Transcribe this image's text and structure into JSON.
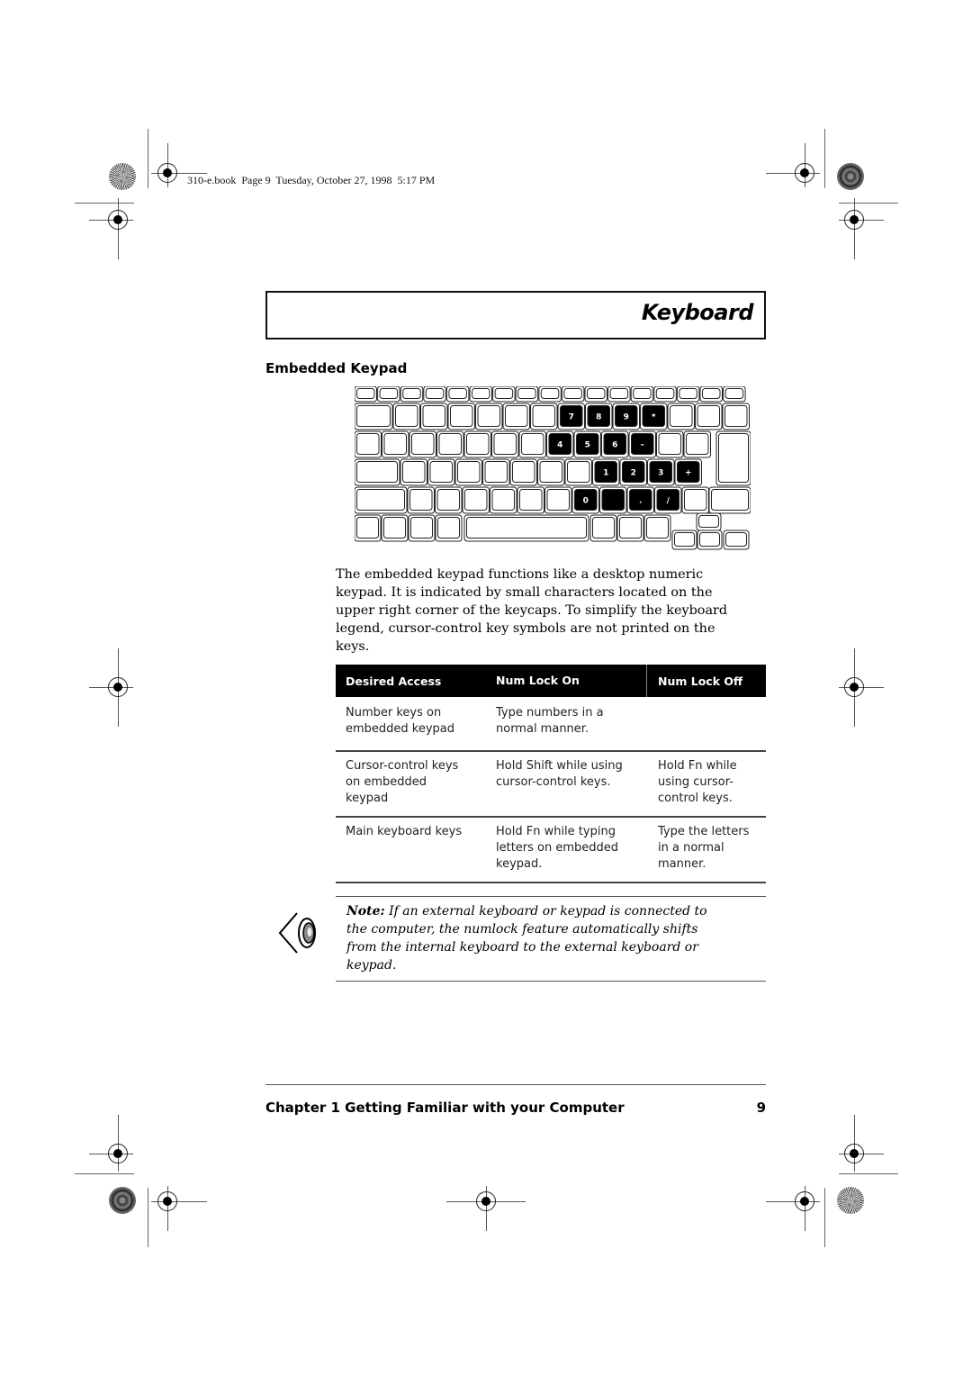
{
  "print_header": {
    "text": "310-e.book  Page 9  Tuesday, October 27, 1998  5:17 PM"
  },
  "page": {
    "section_title": "Keyboard",
    "heading": "Embedded Keypad",
    "figure": {
      "name": "keyboard-layout-illustration",
      "highlighted_keys": [
        "7",
        "8",
        "9",
        "*",
        "4",
        "5",
        "6",
        "–",
        "1",
        "2",
        "3",
        "+",
        "0",
        "",
        ".",
        "/"
      ]
    },
    "body_lines": [
      "The embedded keypad functions like a desktop numeric",
      "keypad.  It is indicated by small characters located on the",
      "upper right corner of the keycaps.  To simplify the keyboard",
      "legend, cursor-control key symbols are not printed on the",
      "keys."
    ],
    "table": {
      "headers": [
        "Desired Access",
        "Num Lock On",
        "Num Lock Off"
      ],
      "rows": [
        {
          "access": [
            "Number keys on",
            "embedded keypad"
          ],
          "on": [
            "Type numbers in a",
            "normal manner."
          ],
          "off": []
        },
        {
          "access": [
            "Cursor-control keys",
            "on embedded",
            "keypad"
          ],
          "on": [
            "Hold Shift while using",
            "cursor-control keys."
          ],
          "off": [
            "Hold Fn while",
            "using cursor-",
            "control keys."
          ]
        },
        {
          "access": [
            "Main keyboard keys"
          ],
          "on": [
            "Hold Fn while typing",
            "letters on embedded",
            "keypad."
          ],
          "off": [
            "Type the letters",
            "in a normal",
            "manner."
          ]
        }
      ]
    },
    "note": {
      "icon": "eye-icon",
      "label": "Note:",
      "lines": [
        " If an external keyboard or keypad is  connected to",
        "the computer, the numlock feature automatically shifts",
        "from the internal keyboard to the external keyboard or",
        "keypad."
      ]
    },
    "footer": {
      "chapter": "Chapter 1  Getting Familiar with your Computer",
      "page_number": "9"
    }
  }
}
